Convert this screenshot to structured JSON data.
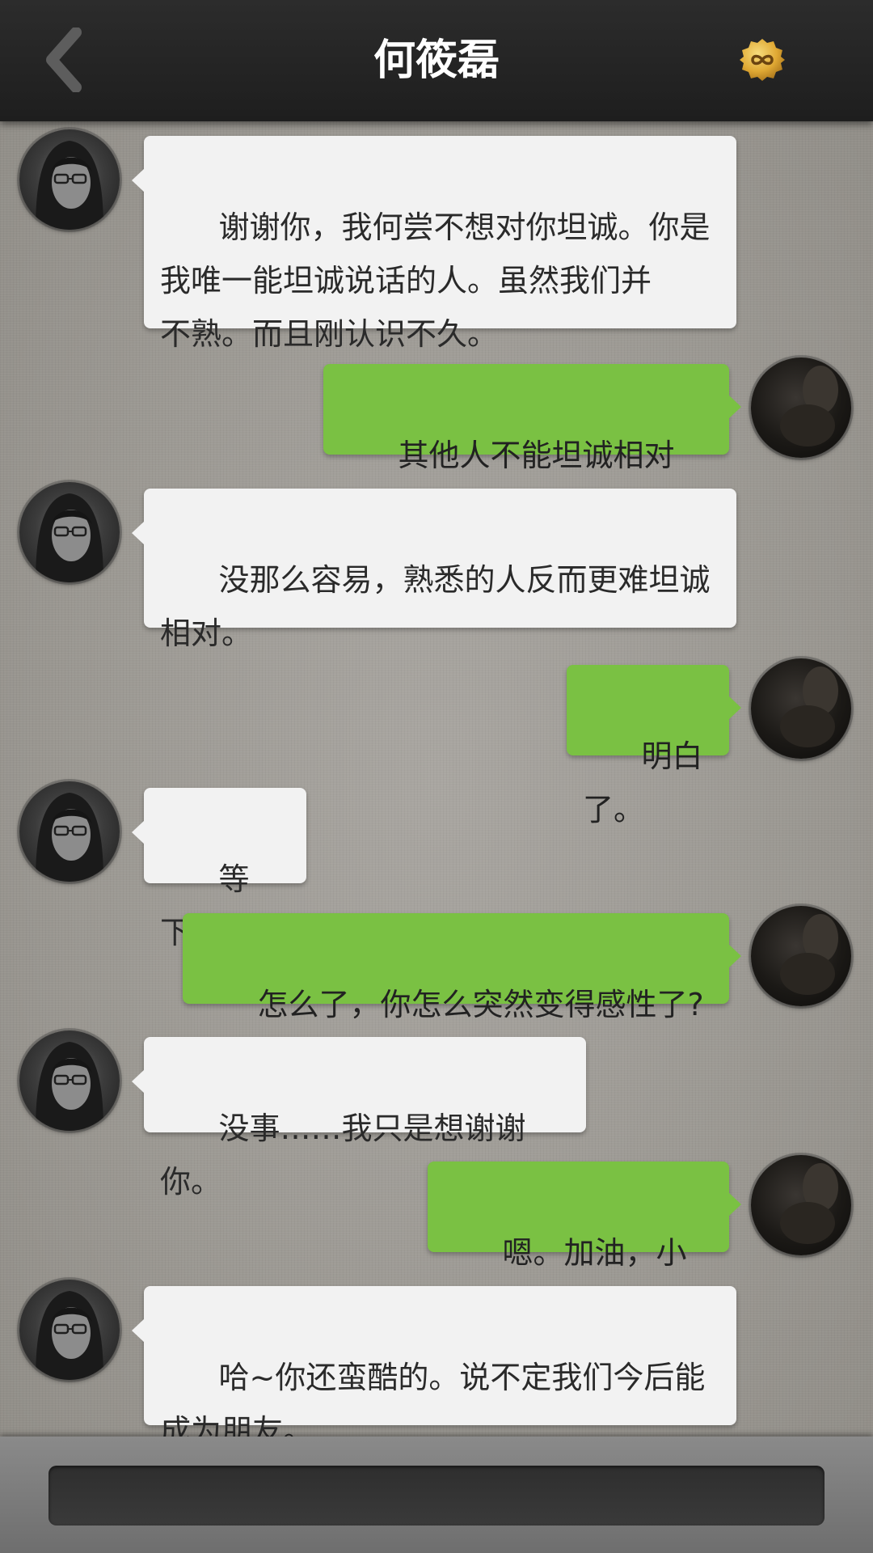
{
  "header": {
    "title": "何筱磊",
    "back_icon": "chevron-left-icon",
    "badge_icon": "infinity-coin-icon",
    "badge_color": "#e8b23a"
  },
  "colors": {
    "header_bg": "#222222",
    "incoming_bubble": "#f2f2f2",
    "outgoing_bubble": "#7ac143",
    "footer_input": "#333333"
  },
  "messages": [
    {
      "side": "left",
      "text": "谢谢你，我何尝不想对你坦诚。你是\n我唯一能坦诚说话的人。虽然我们并\n不熟。而且刚认识不久。"
    },
    {
      "side": "right",
      "text": "其他人不能坦诚相对吗?"
    },
    {
      "side": "left",
      "text": "没那么容易，熟悉的人反而更难坦诚\n相对。"
    },
    {
      "side": "right",
      "text": "明白了。"
    },
    {
      "side": "left",
      "text": "等下……"
    },
    {
      "side": "right",
      "text": "怎么了，你怎么突然变得感性了?"
    },
    {
      "side": "left",
      "text": "没事……我只是想谢谢你。"
    },
    {
      "side": "right",
      "text": "嗯。加油，小何。"
    },
    {
      "side": "left",
      "text": "哈~你还蛮酷的。说不定我们今后能\n成为朋友。"
    }
  ],
  "footer": {
    "input_value": ""
  }
}
